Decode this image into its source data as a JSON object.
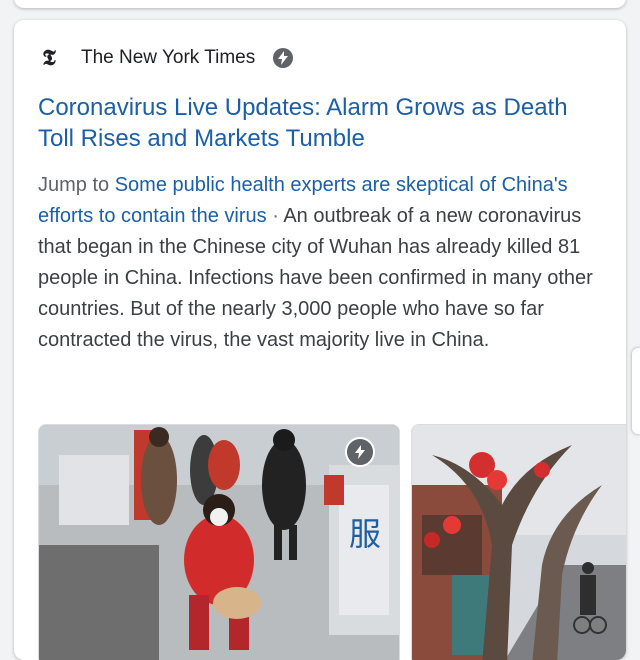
{
  "source": {
    "name": "The New York Times",
    "logo_icon": "nyt-t-logo-icon",
    "amp_icon": "amp-lightning-icon"
  },
  "article": {
    "headline": "Coronavirus Live Updates: Alarm Grows as Death Toll Rises and Markets Tumble",
    "jump_prefix": "Jump to",
    "jump_link": "Some public health experts are skeptical of China's efforts to contain the virus",
    "separator": " · ",
    "snippet": "An outbreak of a new coronavirus that began in the Chinese city of Wuhan has already killed 81 people in China. Infections have been confirmed in many other countries. But of the nearly 3,000 people who have so far contracted the virus, the vast majority live in China."
  },
  "thumbnails": [
    {
      "icon": "amp-lightning-icon",
      "sign_text": "服"
    },
    {
      "icon": "none"
    }
  ],
  "colors": {
    "link": "#1a5fa8",
    "text": "#3c4043",
    "muted": "#5f6368"
  }
}
